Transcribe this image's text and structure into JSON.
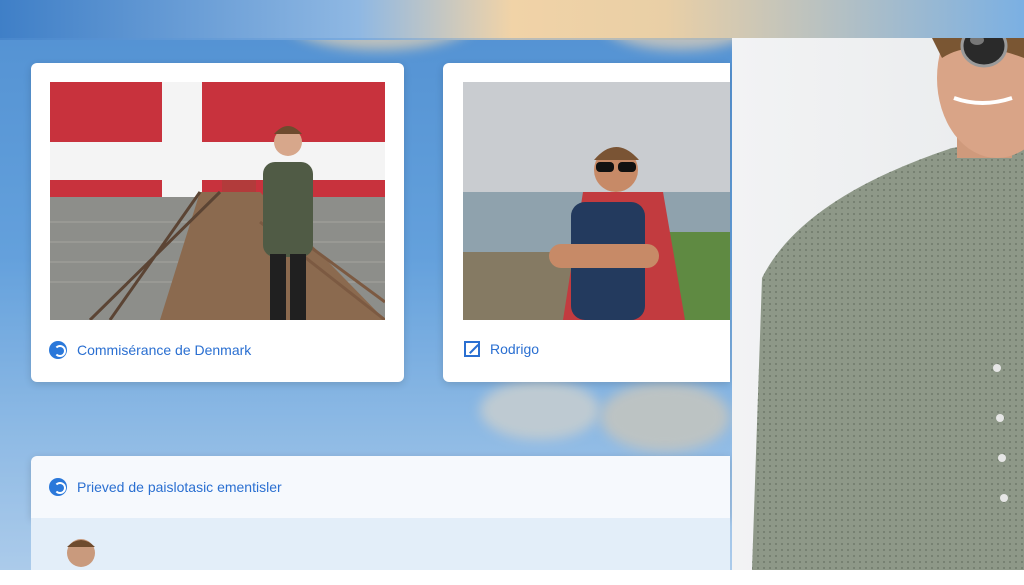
{
  "cards": [
    {
      "caption": "Commisérance de Denmark",
      "icon": "chat-bubble-icon"
    },
    {
      "caption": "Rodrigo",
      "icon": "edit-icon"
    }
  ],
  "bottom_panel": {
    "caption": "Prieved de paislotasic ementisler",
    "icon": "chat-bubble-icon"
  },
  "colors": {
    "accent": "#2a6fd1",
    "card_bg": "#ffffff"
  }
}
